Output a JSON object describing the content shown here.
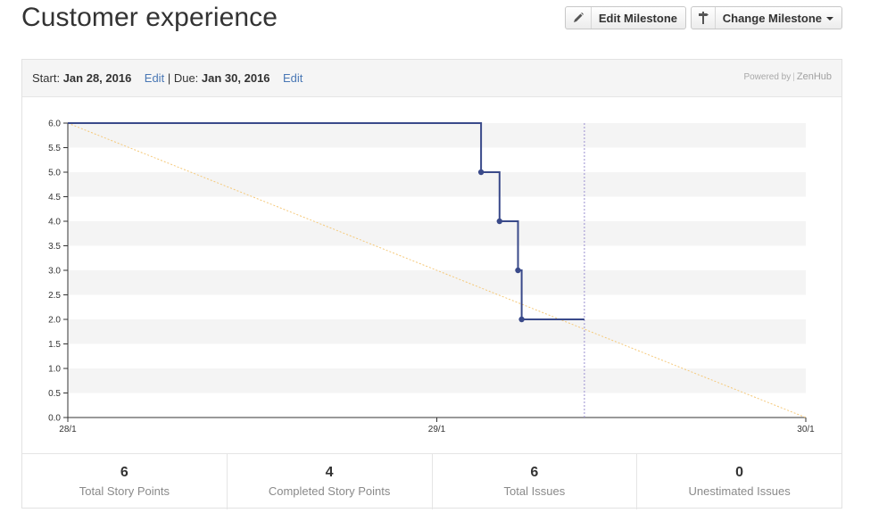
{
  "page": {
    "title": "Customer experience"
  },
  "toolbar": {
    "edit_milestone_label": "Edit Milestone",
    "change_milestone_label": "Change Milestone",
    "edit_icon": "pencil-icon",
    "change_icon": "signpost-icon"
  },
  "milestone": {
    "start_label": "Start:",
    "start_date": "Jan 28, 2016",
    "start_edit_label": "Edit",
    "separator": "|",
    "due_label": "Due:",
    "due_date": "Jan 30, 2016",
    "due_edit_label": "Edit",
    "powered_by": "Powered by",
    "powered_sep": "|",
    "brand": "ZenHub"
  },
  "stats": [
    {
      "value": "6",
      "label": "Total Story Points"
    },
    {
      "value": "4",
      "label": "Completed Story Points"
    },
    {
      "value": "6",
      "label": "Total Issues"
    },
    {
      "value": "0",
      "label": "Unestimated Issues"
    }
  ],
  "chart_data": {
    "type": "line",
    "x_tick_labels": [
      "28/1",
      "29/1",
      "30/1"
    ],
    "xlim": [
      0,
      2
    ],
    "ylim": [
      0,
      6
    ],
    "y_ticks": [
      "0.0",
      "0.5",
      "1.0",
      "1.5",
      "2.0",
      "2.5",
      "3.0",
      "3.5",
      "4.0",
      "4.5",
      "5.0",
      "5.5",
      "6.0"
    ],
    "grid": "alternating horizontal bands",
    "colors": {
      "remaining": "#3a4a8a",
      "ideal": "#f5c97a",
      "today": "#9a8fd0",
      "band": "#f4f4f4"
    },
    "series": [
      {
        "style": "step",
        "x": [
          0,
          1.12,
          1.12,
          1.17,
          1.17,
          1.22,
          1.22,
          1.23,
          1.23,
          1.4
        ],
        "y": [
          6,
          6,
          5,
          5,
          4,
          4,
          3,
          3,
          2,
          2
        ],
        "markers": [
          {
            "x": 1.12,
            "y": 5
          },
          {
            "x": 1.17,
            "y": 4
          },
          {
            "x": 1.22,
            "y": 3
          },
          {
            "x": 1.23,
            "y": 2
          }
        ]
      },
      {
        "style": "dashed",
        "x": [
          0,
          2
        ],
        "y": [
          6,
          0
        ]
      }
    ],
    "today_x": 1.4
  }
}
